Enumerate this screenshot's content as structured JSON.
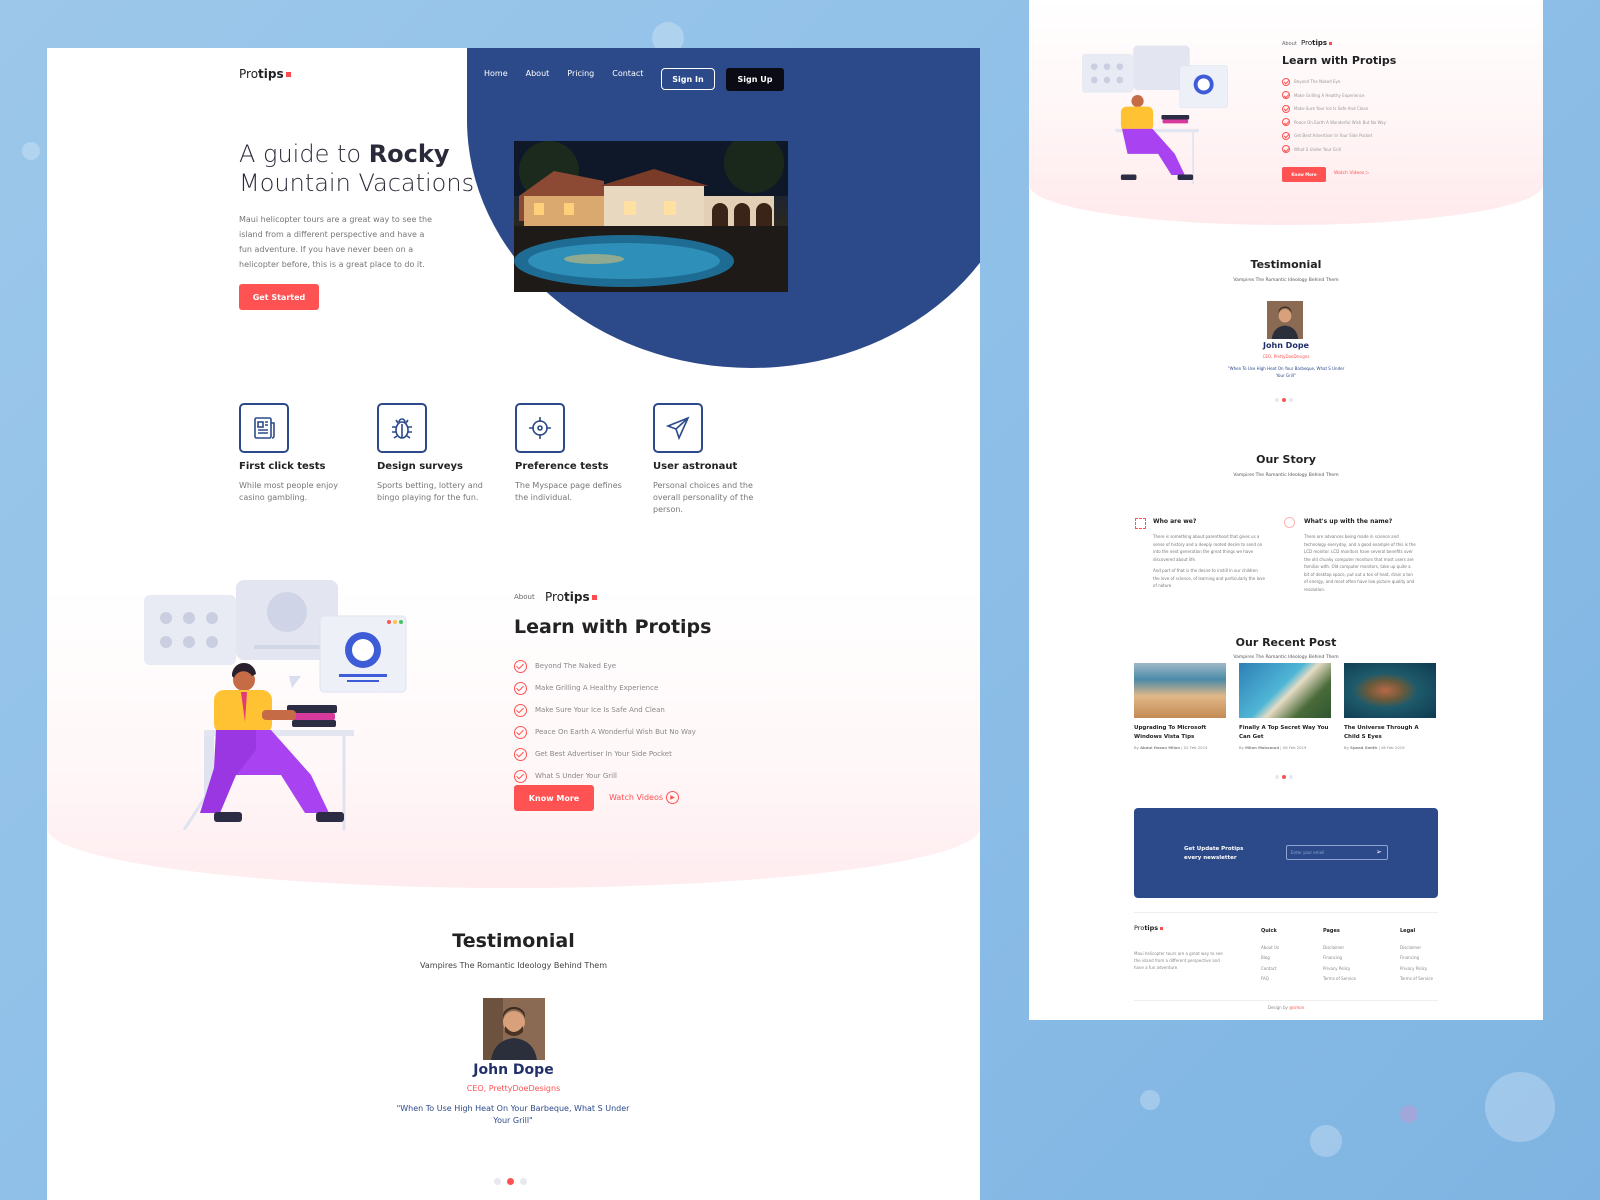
{
  "brand": {
    "name_part1": "Pro",
    "name_part2": "tips",
    "accent": "#ff4b4b",
    "primary": "#2c4a8a"
  },
  "nav": {
    "items": [
      "Home",
      "About",
      "Pricing",
      "Contact"
    ],
    "signin": "Sign In",
    "signup": "Sign Up"
  },
  "hero": {
    "title_line1_plain": "A guide to ",
    "title_line1_bold": "Rocky",
    "title_line2": "Mountain Vacations",
    "text": "Maui helicopter tours are a great way to see the island from a different perspective and have a fun adventure. If you have never been on a helicopter before, this is a great place to do it.",
    "cta": "Get Started"
  },
  "features": [
    {
      "icon": "newspaper-icon",
      "title": "First click tests",
      "text": "While most people enjoy casino gambling."
    },
    {
      "icon": "bug-icon",
      "title": "Design surveys",
      "text": "Sports betting, lottery and bingo playing for the fun."
    },
    {
      "icon": "crosshair-icon",
      "title": "Preference tests",
      "text": "The Myspace page defines the individual."
    },
    {
      "icon": "paper-plane-icon",
      "title": "User astronaut",
      "text": "Personal choices and the overall personality of the person."
    }
  ],
  "about": {
    "label": "About",
    "title": "Learn with Protips",
    "items": [
      "Beyond The Naked Eye",
      "Make Grilling A Healthy Experience",
      "Make Sure Your Ice Is Safe And Clean",
      "Peace On Earth A Wonderful Wish But No Way",
      "Get Best Advertiser In Your Side Pocket",
      "What S Under Your Grill"
    ],
    "cta": "Know More",
    "watch": "Watch Videos"
  },
  "testimonial": {
    "title": "Testimonial",
    "subtitle": "Vampires The Romantic Ideology Behind Them",
    "name": "John Dope",
    "role": "CEO, PrettyDoeDesigns",
    "quote": "\"When To Use High Heat On Your Barbeque, What S Under Your Grill\""
  },
  "story": {
    "title": "Our Story",
    "subtitle": "Vampires The Romantic Ideology Behind Them",
    "col1_title": "Who are we?",
    "col1_text": "There is something about parenthood that gives us a sense of history and a deeply rooted desire to send on into the next generation the great things we have discovered about life.",
    "col1_text2": "And part of that is the desire to instill in our children the love of science, of learning and particularly the love of nature.",
    "col2_title": "What's up with the name?",
    "col2_text": "There are advances being made in science and technology everyday, and a good example of this is the LCD monitor. LCD monitors have several benefits over the old chunky computer monitors that most users are familiar with. Old computer monitors, take up quite a bit of desktop space, put out a ton of heat, drain a ton of energy, and most often have low picture quality and resolution."
  },
  "recent": {
    "title": "Our Recent Post",
    "subtitle": "Vampires The Romantic Ideology Behind Them",
    "posts": [
      {
        "title": "Upgrading To Microsoft Windows Vista Tips",
        "meta_by": "By",
        "author": "Abdul Hasan Milon",
        "date": "02 Feb 2019"
      },
      {
        "title": "Finally A Top Secret Way You Can Get",
        "meta_by": "By",
        "author": "Milon Mahamud",
        "date": "08 Feb 2019"
      },
      {
        "title": "The Universe Through A Child S Eyes",
        "meta_by": "By",
        "author": "Speed Smith",
        "date": "08 Feb 2019"
      }
    ]
  },
  "newsletter": {
    "line1": "Get Update Protips",
    "line2": "every newsletter",
    "placeholder": "Enter your email"
  },
  "footer": {
    "about": "Maui helicopter tours are a great way to see the island from a different perspective and have a fun adventure.",
    "quick_title": "Quick",
    "quick": [
      "About Us",
      "Blog",
      "Contact",
      "FAQ"
    ],
    "pages_title": "Pages",
    "pages": [
      "Disclaimer",
      "Financing",
      "Privacy Policy",
      "Terms of Service"
    ],
    "legal_title": "Legal",
    "legal": [
      "Disclaimer",
      "Financing",
      "Privacy Policy",
      "Terms of Service"
    ],
    "credit_prefix": "Design by ",
    "credit_name": "@smon"
  }
}
